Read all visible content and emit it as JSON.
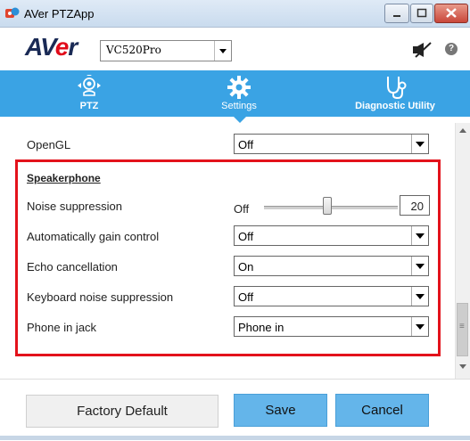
{
  "window": {
    "title": "AVer PTZApp"
  },
  "header": {
    "logo_text_a": "AV",
    "logo_text_e": "e",
    "logo_text_r": "r",
    "device_select_value": "VC520Pro",
    "help_label": "?"
  },
  "tabs": [
    {
      "label": "PTZ",
      "icon": "ptz-camera-icon"
    },
    {
      "label": "Settings",
      "icon": "gear-icon",
      "active": true
    },
    {
      "label": "Diagnostic Utility",
      "icon": "stethoscope-icon"
    }
  ],
  "settings": {
    "opengl": {
      "label": "OpenGL",
      "value": "Off"
    },
    "speakerphone_title": "Speakerphone",
    "noise_suppression": {
      "label": "Noise suppression",
      "min_label": "Off",
      "value": "20",
      "level": 0.47
    },
    "agc": {
      "label": "Automatically gain control",
      "value": "Off"
    },
    "echo": {
      "label": "Echo cancellation",
      "value": "On"
    },
    "keyboard_noise": {
      "label": "Keyboard noise suppression",
      "value": "Off"
    },
    "phone_jack": {
      "label": "Phone in jack",
      "value": "Phone in"
    }
  },
  "footer": {
    "factory_default": "Factory Default",
    "save": "Save",
    "cancel": "Cancel"
  },
  "colors": {
    "tab_bar": "#3aa3e4",
    "highlight": "#e3121b",
    "button_blue": "#64b5ea"
  }
}
